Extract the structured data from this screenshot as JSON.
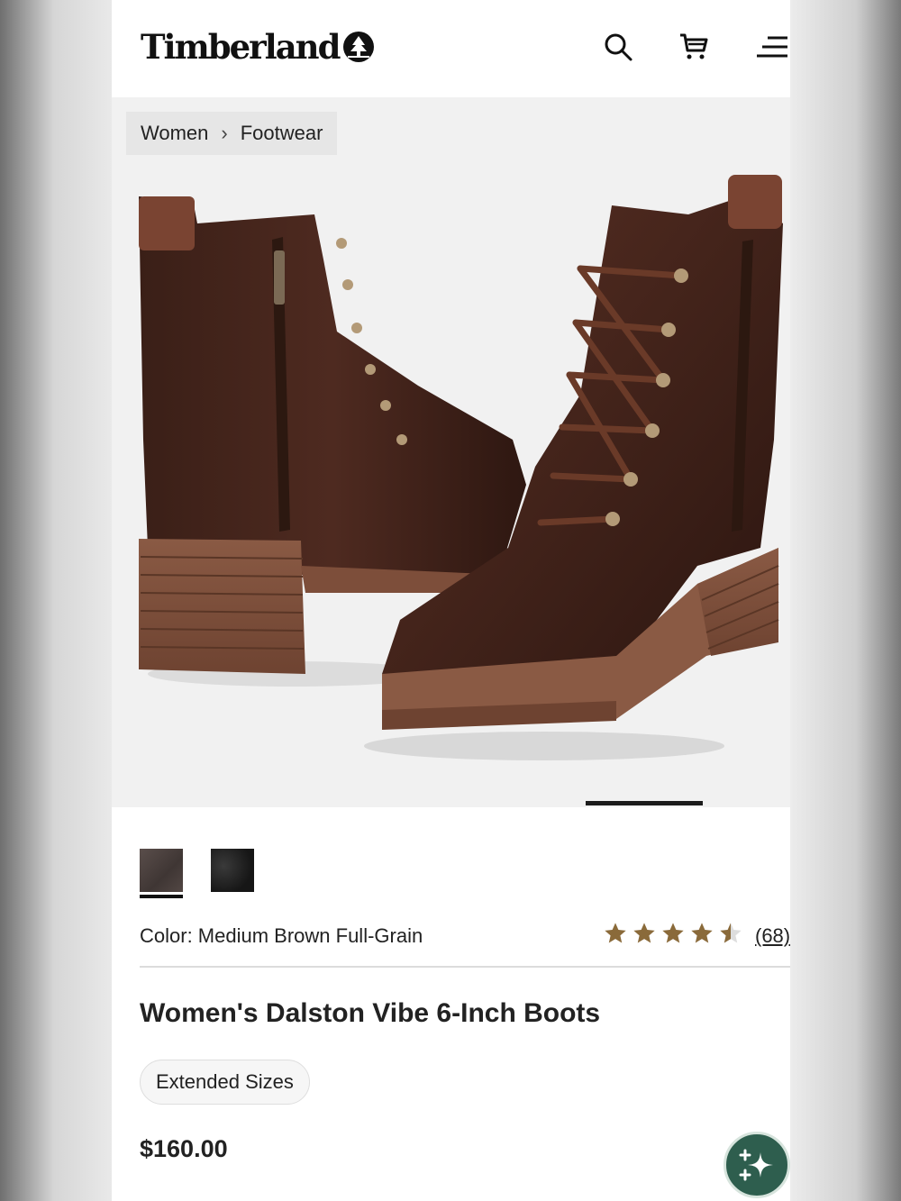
{
  "brand": {
    "name": "Timberland"
  },
  "header": {
    "icons": [
      "search-icon",
      "cart-icon",
      "menu-icon"
    ]
  },
  "breadcrumb": {
    "items": [
      "Women",
      "Footwear"
    ]
  },
  "gallery": {
    "image_alt": "Brown leather lace-up heeled boots",
    "progress_fraction": 0.17
  },
  "product": {
    "color_label": "Color: Medium Brown Full-Grain",
    "rating": 4.5,
    "review_count": "(68)",
    "title": "Women's Dalston Vibe 6-Inch Boots",
    "badge": "Extended Sizes",
    "price": "$160.00"
  },
  "colors": {
    "star": "#8a6a3a",
    "fab": "#2e5e4e"
  }
}
